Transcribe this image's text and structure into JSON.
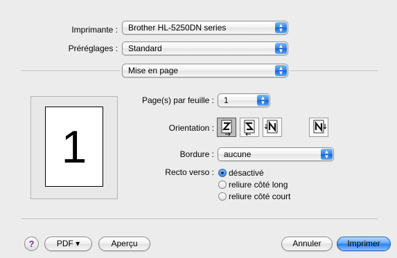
{
  "printer": {
    "label": "Imprimante :",
    "value": "Brother HL-5250DN series"
  },
  "presets": {
    "label": "Préréglages :",
    "value": "Standard"
  },
  "section": {
    "value": "Mise en page"
  },
  "preview": {
    "page_number": "1"
  },
  "pages_per_sheet": {
    "label": "Page(s) par feuille :",
    "value": "1"
  },
  "orientation": {
    "label": "Orientation :",
    "selected_index": 0
  },
  "border": {
    "label": "Bordure :",
    "value": "aucune"
  },
  "duplex": {
    "label": "Recto verso :",
    "options": [
      "désactivé",
      "reliure côté long",
      "reliure côté court"
    ],
    "selected_index": 0
  },
  "buttons": {
    "help": "?",
    "pdf": "PDF ▾",
    "preview": "Aperçu",
    "cancel": "Annuler",
    "print": "Imprimer"
  },
  "colors": {
    "accent": "#2f86e8",
    "background": "#ececec"
  }
}
